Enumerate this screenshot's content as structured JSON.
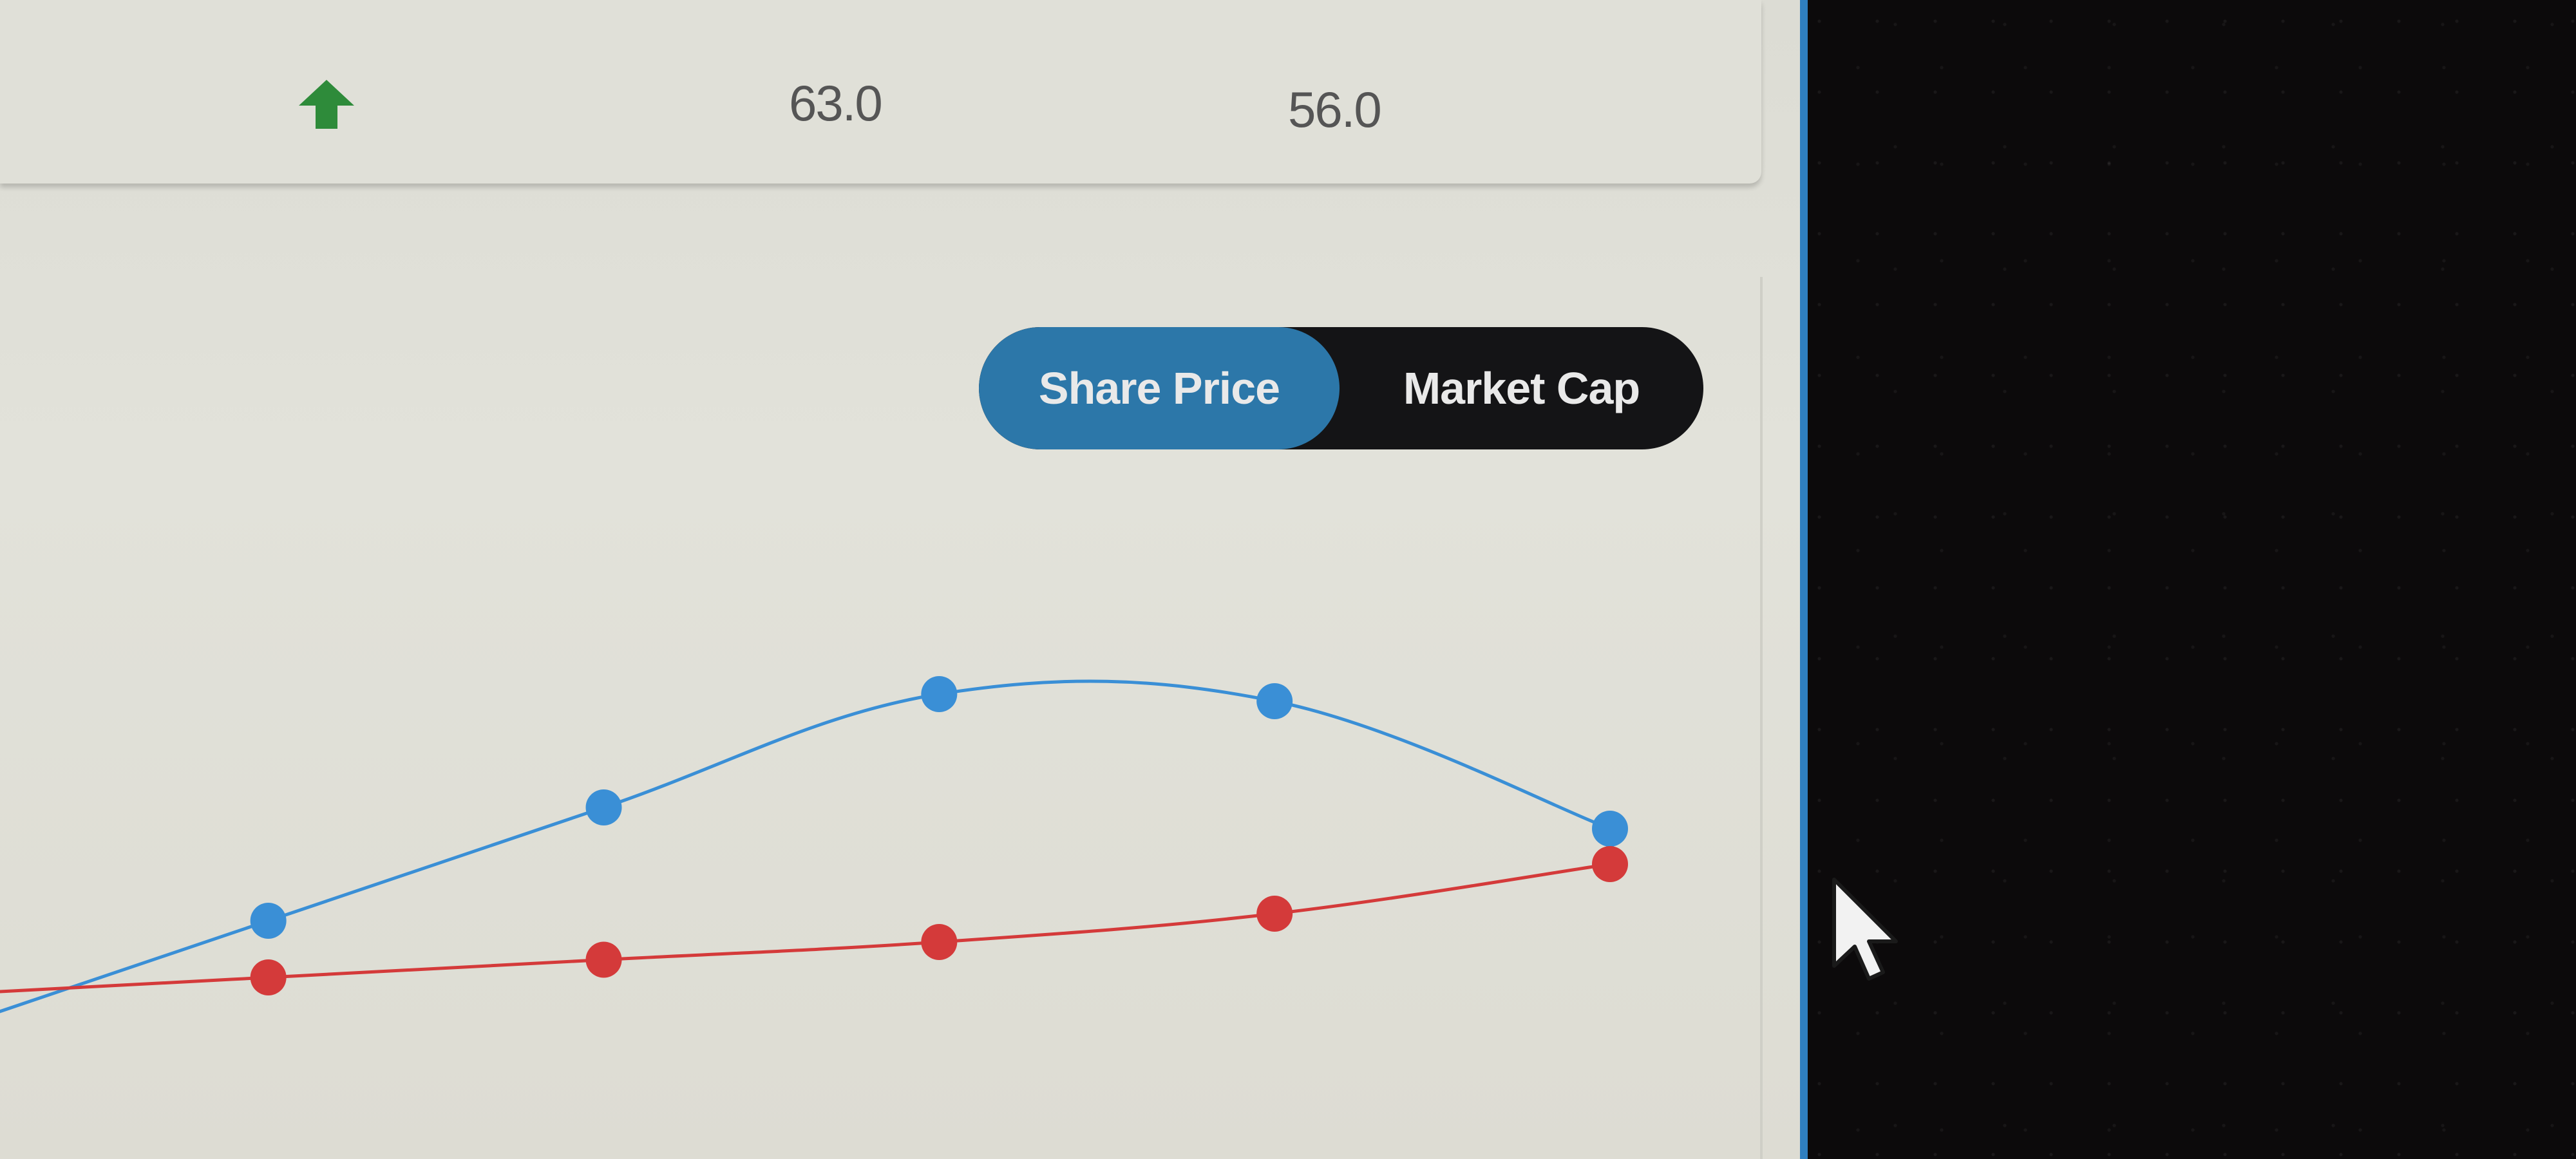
{
  "stats": {
    "trend_icon": "arrow-up-icon",
    "trend_color": "#2e8b3a",
    "values": [
      "63.0",
      "56.0"
    ]
  },
  "toggle": {
    "options": [
      "Share Price",
      "Market Cap"
    ],
    "selected": "Share Price",
    "active_color": "#2c77a9",
    "inactive_color": "#141416"
  },
  "chart_data": {
    "type": "line",
    "grid": false,
    "series": [
      {
        "color": "#3a8fd6",
        "points": [
          [
            0.0,
            1.0
          ],
          [
            1.0,
            2.6
          ],
          [
            2.0,
            4.2
          ],
          [
            3.0,
            4.1
          ],
          [
            4.0,
            2.3
          ]
        ]
      },
      {
        "color": "#d43a3a",
        "points": [
          [
            0.0,
            0.2
          ],
          [
            1.0,
            0.45
          ],
          [
            2.0,
            0.7
          ],
          [
            3.0,
            1.1
          ],
          [
            4.0,
            1.8
          ]
        ]
      }
    ]
  },
  "cursor_icon": "mouse-pointer-icon"
}
